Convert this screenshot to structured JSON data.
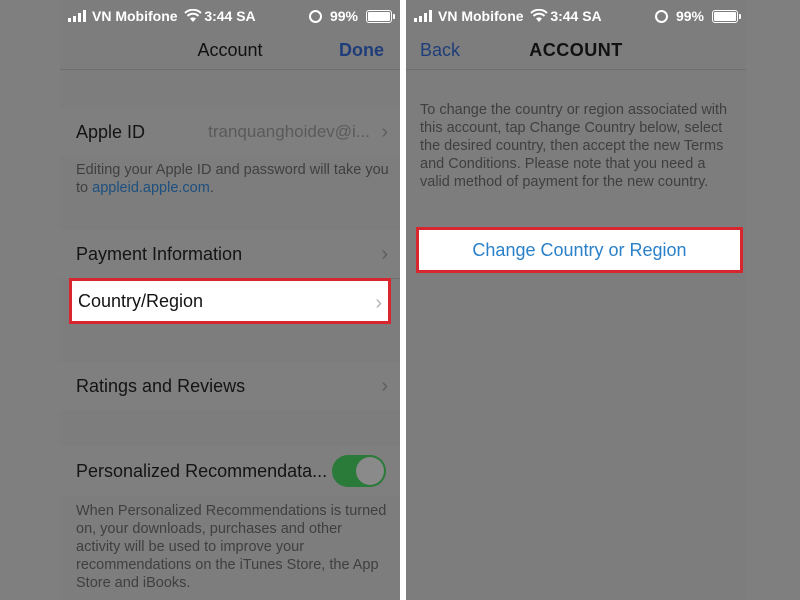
{
  "left": {
    "status": {
      "carrier": "VN Mobifone",
      "time": "3:44 SA",
      "battery": "99%"
    },
    "nav": {
      "title": "Account",
      "done_label": "Done"
    },
    "apple_id": {
      "label": "Apple ID",
      "value": "tranquanghoidev@i..."
    },
    "apple_id_note": {
      "text": "Editing your Apple ID and password will take you to ",
      "link": "appleid.apple.com",
      "suffix": "."
    },
    "payment_label": "Payment Information",
    "country_label": "Country/Region",
    "ratings_label": "Ratings and Reviews",
    "personalized": {
      "label": "Personalized Recommendata...",
      "enabled": true
    },
    "personalized_note": "When Personalized Recommendations is turned on, your downloads, purchases and other activity will be used to improve your recommendations on the iTunes Store, the App Store and iBooks."
  },
  "right": {
    "status": {
      "carrier": "VN Mobifone",
      "time": "3:44 SA",
      "battery": "99%"
    },
    "nav": {
      "title": "ACCOUNT",
      "back_label": "Back"
    },
    "description": "To change the country or region associated with this account, tap Change Country below, select the desired country, then accept the new Terms and Conditions. Please note that you need a valid method of payment for the new country.",
    "change_button_label": "Change Country or Region"
  },
  "icons": [
    "signal-icon",
    "wifi-icon",
    "rotation-lock-icon",
    "battery-icon",
    "chevron-right-icon"
  ],
  "colors": {
    "highlight_border": "#d8262e",
    "link": "#2a80c9",
    "toggle_on": "#2a7a3a"
  }
}
